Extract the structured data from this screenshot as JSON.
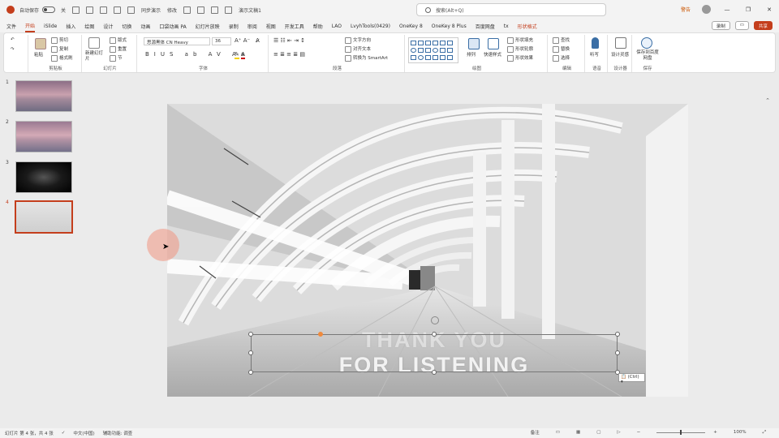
{
  "titlebar": {
    "autosave": "自动保存",
    "toggle_state": "关",
    "qat_label_1": "同步演示",
    "qat_label_2": "修改",
    "file_name": "演示文稿1",
    "search_placeholder": "搜索(Alt+Q)",
    "warning": "警告",
    "minimize": "—",
    "restore": "❐",
    "close": "✕"
  },
  "tabs": [
    "文件",
    "开始",
    "iSlide",
    "插入",
    "绘图",
    "设计",
    "切换",
    "动画",
    "口袋动画 PA",
    "幻灯片放映",
    "录制",
    "审阅",
    "视图",
    "开发工具",
    "帮助",
    "LAO",
    "LvyhTools(0429)",
    "OneKey 8",
    "OneKey 8 Plus",
    "百度网盘",
    "tx",
    "形状格式"
  ],
  "tab_right": {
    "record": "录制",
    "comment": "",
    "share": "共享"
  },
  "ribbon": {
    "clipboard": {
      "label": "剪贴板",
      "paste": "粘贴",
      "cut": "剪切",
      "copy": "复制",
      "format_painter": "格式刷"
    },
    "slides": {
      "label": "幻灯片",
      "new_slide": "新建幻灯片",
      "layout": "版式",
      "reset": "重置",
      "section": "节"
    },
    "font": {
      "label": "字体",
      "font_name": "思源黑体 CN Heavy",
      "font_size": "36"
    },
    "paragraph": {
      "label": "段落",
      "text_direction": "文字方向",
      "align_text": "对齐文本",
      "smartart": "转换为 SmartArt"
    },
    "drawing": {
      "label": "绘图",
      "arrange": "排列",
      "quick_styles": "快速样式",
      "shape_fill": "形状填充",
      "shape_outline": "形状轮廓",
      "shape_effects": "形状效果"
    },
    "editing": {
      "label": "编辑",
      "find": "查找",
      "replace": "替换",
      "select": "选择"
    },
    "voice": {
      "label": "语音",
      "dictate": "听写"
    },
    "designer": {
      "label": "设计器",
      "designer": "设计灵感"
    },
    "save": {
      "label": "保存",
      "save_to_baidu": "保存到百度网盘"
    }
  },
  "slides": [
    {
      "num": "1"
    },
    {
      "num": "2"
    },
    {
      "num": "3"
    },
    {
      "num": "4",
      "active": true
    }
  ],
  "slide_text": {
    "line1": "THANK YOU",
    "line2": "FOR LISTENING"
  },
  "paste_options": "(Ctrl)",
  "statusbar": {
    "slide_info": "幻灯片 第 4 张，共 4 张",
    "language": "中文(中国)",
    "accessibility": "辅助功能: 调查",
    "notes": "备注",
    "zoom": "100%"
  },
  "colors": {
    "accent": "#c43e1c",
    "selection_handle": "#f08a3c"
  }
}
